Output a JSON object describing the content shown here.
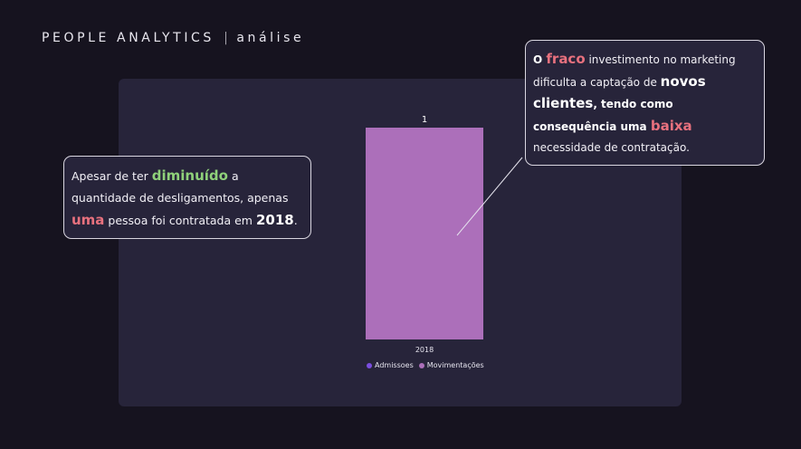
{
  "header": {
    "title": "PEOPLE ANALYTICS",
    "separator": "|",
    "subtitle": "análise"
  },
  "chart_data": {
    "type": "bar",
    "categories": [
      "2018"
    ],
    "series": [
      {
        "name": "Admissoes",
        "values": [
          0
        ],
        "color": "#7b4ee0"
      },
      {
        "name": "Movimentações",
        "values": [
          1
        ],
        "color": "#ac6fba"
      }
    ],
    "data_labels": [
      "1"
    ],
    "ylim": [
      0,
      1
    ],
    "grid": false,
    "legend_position": "bottom"
  },
  "callouts": {
    "left": {
      "p1": "Apesar de ter ",
      "h1": "diminuído",
      "p2": " a quantidade de desligamentos, apenas ",
      "h2": "uma",
      "p3": " pessoa foi contratada em ",
      "h3": "2018",
      "p4": "."
    },
    "right": {
      "p1": "O ",
      "h1": "fraco",
      "p2": " investimento no marketing dificulta a captação de ",
      "h2": "novos clientes",
      "h3": ", tendo como consequência uma ",
      "h4": "baixa",
      "p3": " necessidade de contratação."
    }
  },
  "colors": {
    "background": "#16131f",
    "panel": "#27243a",
    "bar": "#ac6fba",
    "highlight_green": "#8fd17a",
    "highlight_pink": "#e8717e"
  }
}
